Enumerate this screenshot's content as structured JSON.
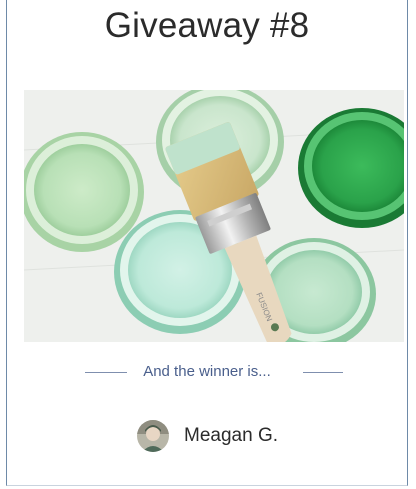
{
  "page": {
    "title": "Giveaway #8"
  },
  "image": {
    "alt": "paint-cans-and-brush-photo",
    "brush_text": "FUSION",
    "colors": {
      "background": "#eef0ed",
      "pale_green": "#bfe3bf",
      "mint": "#bfead9",
      "bright_green": "#2aa24a",
      "sage": "#c9e5cc"
    }
  },
  "winner": {
    "intro_label": "And the winner is...",
    "name": "Meagan G.",
    "avatar_icon": "user-avatar-photo"
  },
  "colors": {
    "divider": "#7f8fae",
    "intro_text": "#4a5f8c",
    "title_text": "#2b2b2b"
  }
}
